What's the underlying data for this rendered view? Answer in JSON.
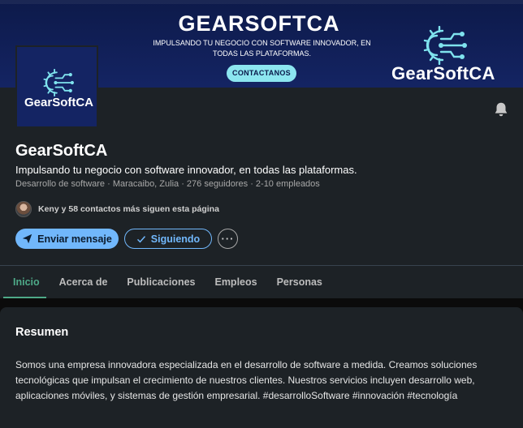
{
  "banner": {
    "title": "GEARSOFTCA",
    "subtitle": "IMPULSANDO TU NEGOCIO CON SOFTWARE INNOVADOR, EN TODAS LAS PLATAFORMAS.",
    "cta_label": "CONTACTANOS",
    "logo_text": "GearSoftCA"
  },
  "logo": {
    "text": "GearSoftCA"
  },
  "profile": {
    "name": "GearSoftCA",
    "tagline": "Impulsando tu negocio con software innovador, en todas las plataformas.",
    "meta": "Desarrollo de software · Maracaibo, Zulia · 276 seguidores · 2-10 empleados",
    "connections": "Keny y 58 contactos más siguen esta página"
  },
  "actions": {
    "message_label": "Enviar mensaje",
    "following_label": "Siguiendo",
    "more_label": "···"
  },
  "tabs": [
    {
      "label": "Inicio",
      "active": true
    },
    {
      "label": "Acerca de"
    },
    {
      "label": "Publicaciones"
    },
    {
      "label": "Empleos"
    },
    {
      "label": "Personas"
    }
  ],
  "summary": {
    "title": "Resumen",
    "body": "Somos una empresa innovadora especializada en el desarrollo de software a medida. Creamos soluciones tecnológicas que impulsan el crecimiento de nuestros clientes. Nuestros servicios incluyen desarrollo web, aplicaciones móviles, y sistemas de gestión empresarial. #desarrolloSoftware #innovación #tecnología"
  },
  "icons": {
    "bell": "bell-icon",
    "send": "send-icon",
    "check": "check-icon",
    "logo": "gear-circuit-icon"
  },
  "colors": {
    "accent_blue": "#71b7fb",
    "active_tab": "#4ea988",
    "banner_bg": "#142463",
    "cta_bg": "#8ce6f0"
  }
}
